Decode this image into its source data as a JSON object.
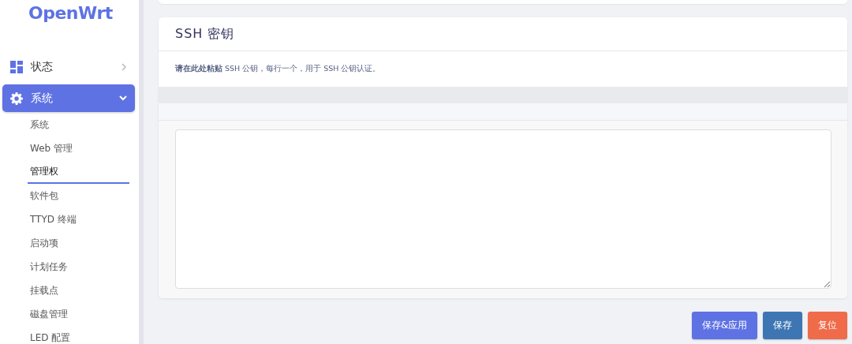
{
  "logo": "OpenWrt",
  "menu": [
    {
      "label": "状态",
      "kind": "dashboard",
      "selected": false,
      "expanded": false
    },
    {
      "label": "系统",
      "kind": "gear",
      "selected": true,
      "expanded": true,
      "children": [
        {
          "label": "系统",
          "selected": false
        },
        {
          "label": "Web 管理",
          "selected": false
        },
        {
          "label": "管理权",
          "selected": true
        },
        {
          "label": "软件包",
          "selected": false
        },
        {
          "label": "TTYD 终端",
          "selected": false
        },
        {
          "label": "启动项",
          "selected": false
        },
        {
          "label": "计划任务",
          "selected": false
        },
        {
          "label": "挂载点",
          "selected": false
        },
        {
          "label": "磁盘管理",
          "selected": false
        },
        {
          "label": "LED 配置",
          "selected": false
        }
      ]
    }
  ],
  "section": {
    "title": "SSH 密钥",
    "description": "**请在此处粘贴** SSH 公钥，每行一个，用于 SSH 公钥认证。"
  },
  "buttons": [
    {
      "label": "保存&应用",
      "kind": "apply"
    },
    {
      "label": "保存",
      "kind": "save"
    },
    {
      "label": "复位",
      "kind": "reset"
    }
  ]
}
